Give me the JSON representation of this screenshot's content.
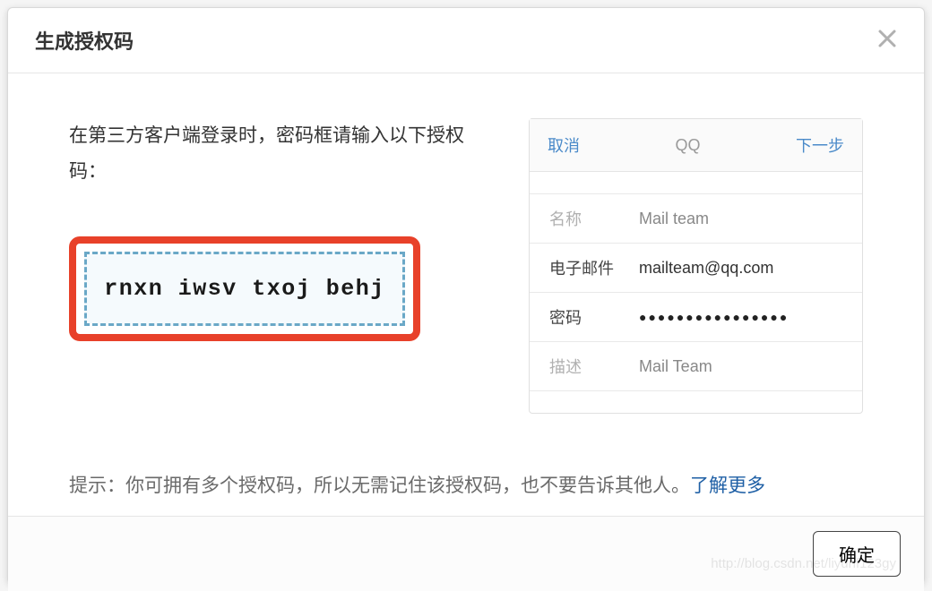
{
  "modal": {
    "title": "生成授权码",
    "instruction": "在第三方客户端登录时，密码框请输入以下授权码：",
    "auth_code": "rnxn iwsv txoj behj",
    "tip_prefix": "提示：",
    "tip_text": "你可拥有多个授权码，所以无需记住该授权码，也不要告诉其他人。",
    "learn_more": "了解更多",
    "confirm_label": "确定"
  },
  "phone_preview": {
    "nav": {
      "cancel": "取消",
      "title": "QQ",
      "next": "下一步"
    },
    "fields": {
      "name": {
        "label": "名称",
        "value": "Mail team"
      },
      "email": {
        "label": "电子邮件",
        "value": "mailteam@qq.com"
      },
      "password": {
        "label": "密码",
        "value": "●●●●●●●●●●●●●●●●"
      },
      "desc": {
        "label": "描述",
        "value": "Mail Team"
      }
    }
  },
  "watermark": "http://blog.csdn.net/liyunf123gy"
}
